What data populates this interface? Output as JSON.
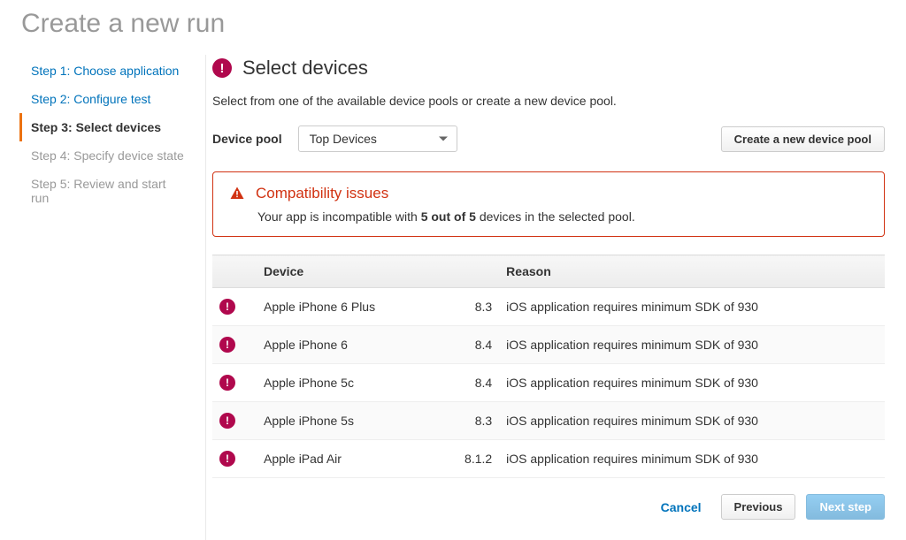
{
  "page_title": "Create a new run",
  "sidebar": {
    "steps": [
      {
        "label": "Step 1: Choose application",
        "state": "link"
      },
      {
        "label": "Step 2: Configure test",
        "state": "link"
      },
      {
        "label": "Step 3: Select devices",
        "state": "active"
      },
      {
        "label": "Step 4: Specify device state",
        "state": "future"
      },
      {
        "label": "Step 5: Review and start run",
        "state": "future"
      }
    ]
  },
  "main": {
    "heading": "Select devices",
    "description": "Select from one of the available device pools or create a new device pool.",
    "pool_label": "Device pool",
    "pool_selected": "Top Devices",
    "create_pool_button": "Create a new device pool"
  },
  "alert": {
    "title": "Compatibility issues",
    "body_prefix": "Your app is incompatible with ",
    "body_bold": "5 out of 5",
    "body_suffix": " devices in the selected pool."
  },
  "table": {
    "headers": {
      "device": "Device",
      "reason": "Reason"
    },
    "rows": [
      {
        "device": "Apple iPhone 6 Plus",
        "version": "8.3",
        "reason": "iOS application requires minimum SDK of 930"
      },
      {
        "device": "Apple iPhone 6",
        "version": "8.4",
        "reason": "iOS application requires minimum SDK of 930"
      },
      {
        "device": "Apple iPhone 5c",
        "version": "8.4",
        "reason": "iOS application requires minimum SDK of 930"
      },
      {
        "device": "Apple iPhone 5s",
        "version": "8.3",
        "reason": "iOS application requires minimum SDK of 930"
      },
      {
        "device": "Apple iPad Air",
        "version": "8.1.2",
        "reason": "iOS application requires minimum SDK of 930"
      }
    ]
  },
  "footer": {
    "cancel": "Cancel",
    "previous": "Previous",
    "next": "Next step"
  }
}
